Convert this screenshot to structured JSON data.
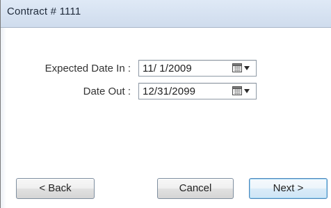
{
  "window": {
    "title": "Contract # 1111"
  },
  "form": {
    "expected_date_label": "Expected Date In :",
    "expected_date_value": "11/  1/2009",
    "date_out_label": "Date Out :",
    "date_out_value": "12/31/2099"
  },
  "buttons": {
    "back_label": "< Back",
    "cancel_label": "Cancel",
    "next_label": "Next >"
  },
  "icons": {
    "calendar": "calendar-icon",
    "dropdown": "chevron-down-icon"
  },
  "colors": {
    "header_gradient_top": "#dfe9f6",
    "header_gradient_bottom": "#cfdced",
    "focus_button_border": "#4e87bc"
  }
}
